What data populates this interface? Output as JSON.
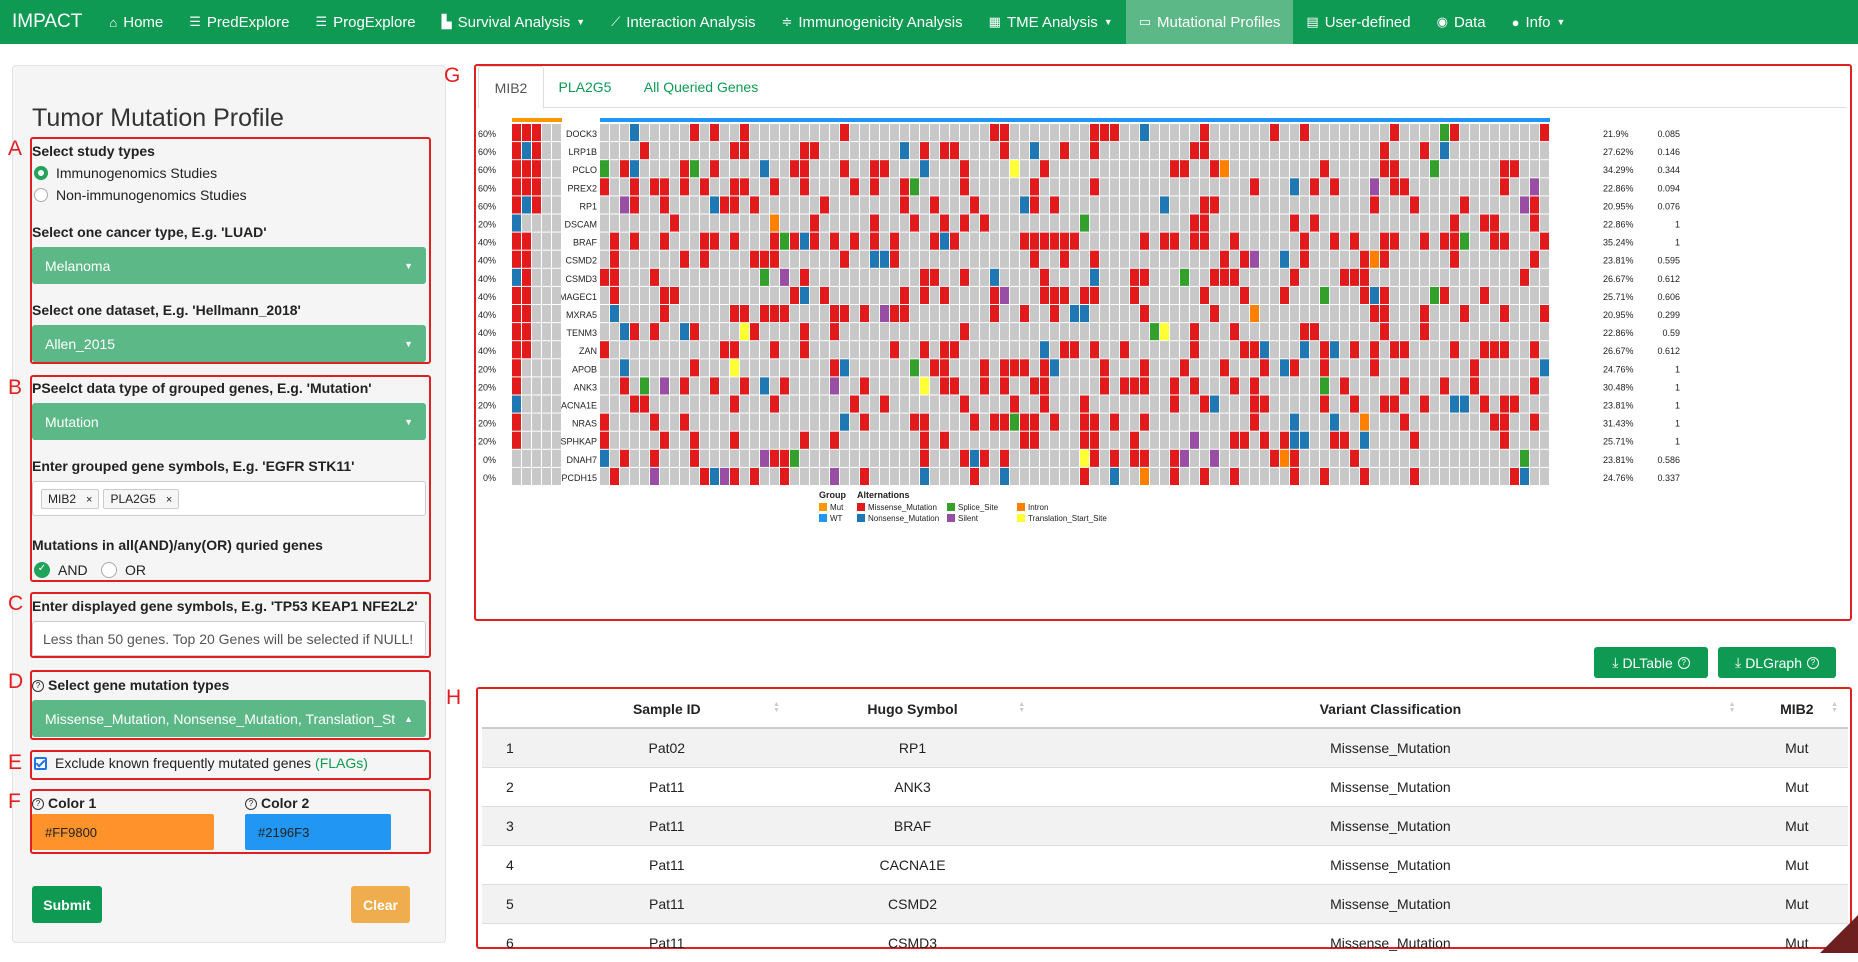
{
  "nav": {
    "brand": "IMPACT",
    "items": [
      {
        "label": "Home",
        "icon": "⌂"
      },
      {
        "label": "PredExplore",
        "icon": "☰"
      },
      {
        "label": "ProgExplore",
        "icon": "☰"
      },
      {
        "label": "Survival Analysis",
        "icon": "▙"
      },
      {
        "label": "Interaction Analysis",
        "icon": "⟋"
      },
      {
        "label": "Immunogenicity Analysis",
        "icon": "≑"
      },
      {
        "label": "TME Analysis",
        "icon": "▦"
      },
      {
        "label": "Mutational Profiles",
        "icon": "▭"
      },
      {
        "label": "User-defined",
        "icon": "▤"
      },
      {
        "label": "Data",
        "icon": "◉"
      },
      {
        "label": "Info",
        "icon": "●"
      }
    ]
  },
  "panel": {
    "title": "Tumor Mutation Profile",
    "letters": [
      "A",
      "B",
      "C",
      "D",
      "E",
      "F",
      "G",
      "H"
    ],
    "study_label": "Select study types",
    "study_opt1": "Immunogenomics Studies",
    "study_opt2": "Non-immunogenomics Studies",
    "cancer_label": "Select one cancer type, E.g. 'LUAD'",
    "cancer_value": "Melanoma",
    "dataset_label": "Select one dataset, E.g. 'Hellmann_2018'",
    "dataset_value": "Allen_2015",
    "datatype_label": "PSeelct data type of grouped genes, E.g. 'Mutation'",
    "datatype_value": "Mutation",
    "genes_label": "Enter grouped gene symbols, E.g. 'EGFR STK11'",
    "gene_tags": [
      "MIB2",
      "PLA2G5"
    ],
    "logic_label": "Mutations in all(AND)/any(OR) quried genes",
    "logic_and": "AND",
    "logic_or": "OR",
    "display_label": "Enter displayed gene symbols, E.g. 'TP53 KEAP1 NFE2L2'",
    "display_placeholder": "Less than 50 genes. Top 20 Genes will be selected if NULL!",
    "muttype_label": "Select gene mutation types",
    "muttype_value": "Missense_Mutation, Nonsense_Mutation, Translation_St",
    "exclude_label": "Exclude known frequently mutated genes",
    "exclude_link": "(FLAGs)",
    "color1_label": "Color 1",
    "color1_value": "#FF9800",
    "color2_label": "Color 2",
    "color2_value": "#2196F3",
    "submit": "Submit",
    "clear": "Clear"
  },
  "tabs": [
    "MIB2",
    "PLA2G5",
    "All Queried Genes"
  ],
  "colors": {
    "brand_green": "#0e9a52",
    "group_mut": "#ff9800",
    "group_wt": "#2196f3",
    "missense": "#e31a1c",
    "nonsense": "#1f78b4",
    "splice": "#33a02c",
    "silent": "#984ea3",
    "intron": "#ff7f00",
    "translation_start": "#ffff33",
    "none": "#c8c8c8",
    "highlight_red": "#e02020",
    "clear_btn": "#f0ad4e"
  },
  "oncoplot": {
    "genes": [
      "DOCK3",
      "LRP1B",
      "PCLO",
      "PREX2",
      "RP1",
      "DSCAM",
      "BRAF",
      "CSMD2",
      "CSMD3",
      "MAGEC1",
      "MXRA5",
      "TENM3",
      "ZAN",
      "APOB",
      "ANK3",
      "CACNA1E",
      "NRAS",
      "SPHKAP",
      "DNAH7",
      "PCDH15"
    ],
    "left_pct": [
      "60%",
      "60%",
      "60%",
      "60%",
      "60%",
      "20%",
      "40%",
      "40%",
      "40%",
      "40%",
      "40%",
      "40%",
      "40%",
      "20%",
      "20%",
      "20%",
      "20%",
      "20%",
      "0%",
      "0%"
    ],
    "right_pct": [
      "21.9%",
      "27.62%",
      "34.29%",
      "22.86%",
      "20.95%",
      "22.86%",
      "35.24%",
      "23.81%",
      "26.67%",
      "25.71%",
      "20.95%",
      "22.86%",
      "26.67%",
      "24.76%",
      "30.48%",
      "23.81%",
      "31.43%",
      "25.71%",
      "23.81%",
      "24.76%"
    ],
    "pvals": [
      "0.085",
      "0.146",
      "0.344",
      "0.094",
      "0.076",
      "1",
      "1",
      "0.595",
      "0.612",
      "0.606",
      "0.299",
      "0.59",
      "0.612",
      "1",
      "1",
      "1",
      "1",
      "1",
      "0.586",
      "0.337"
    ],
    "mut_samples": 5,
    "wt_samples": 95,
    "legend": {
      "group_title": "Group",
      "alt_title": "Alternations",
      "group_items": [
        "Mut",
        "WT"
      ],
      "alt_items": [
        "Missense_Mutation",
        "Nonsense_Mutation",
        "Splice_Site",
        "Silent",
        "Intron",
        "Translation_Start_Site"
      ]
    }
  },
  "downloads": {
    "table": "DLTable",
    "graph": "DLGraph"
  },
  "table": {
    "headers": [
      "",
      "Sample ID",
      "Hugo Symbol",
      "Variant Classification",
      "MIB2"
    ],
    "rows": [
      [
        "1",
        "Pat02",
        "RP1",
        "Missense_Mutation",
        "Mut"
      ],
      [
        "2",
        "Pat11",
        "ANK3",
        "Missense_Mutation",
        "Mut"
      ],
      [
        "3",
        "Pat11",
        "BRAF",
        "Missense_Mutation",
        "Mut"
      ],
      [
        "4",
        "Pat11",
        "CACNA1E",
        "Missense_Mutation",
        "Mut"
      ],
      [
        "5",
        "Pat11",
        "CSMD2",
        "Missense_Mutation",
        "Mut"
      ],
      [
        "6",
        "Pat11",
        "CSMD3",
        "Missense_Mutation",
        "Mut"
      ]
    ]
  }
}
